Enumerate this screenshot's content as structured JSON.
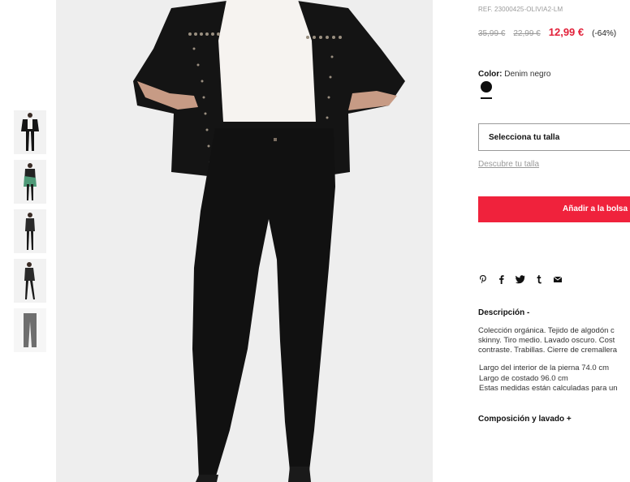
{
  "product": {
    "ref": "REF. 23000425-OLIVIA2-LM",
    "prices": {
      "original": "35,99 €",
      "previous": "22,99 €",
      "sale": "12,99 €",
      "discount": "(-64%)"
    },
    "color": {
      "label": "Color:",
      "value": "Denim negro",
      "swatch": "#0d0d0d"
    }
  },
  "actions": {
    "size_select_label": "Selecciona tu talla",
    "size_guide_label": "Descubre tu talla",
    "add_to_bag_label": "Añadir a la bolsa",
    "add_to_bag_color": "#f0223c"
  },
  "share": [
    "pinterest-icon",
    "facebook-icon",
    "twitter-icon",
    "tumblr-icon",
    "email-icon"
  ],
  "description": {
    "title": "Descripción  -",
    "lines": [
      "Colección orgánica. Tejido de algodón c",
      "skinny. Tiro medio. Lavado oscuro. Cost",
      "contraste. Trabillas. Cierre de cremallera"
    ],
    "measures": [
      "Largo del interior de la pierna 74.0 cm",
      "Largo de costado 96.0 cm",
      "Estas medidas están calculadas para un"
    ]
  },
  "composition": {
    "title": "Composición y lavado  +"
  },
  "gallery": {
    "thumbnail_count": 5,
    "selected_index": 0
  }
}
